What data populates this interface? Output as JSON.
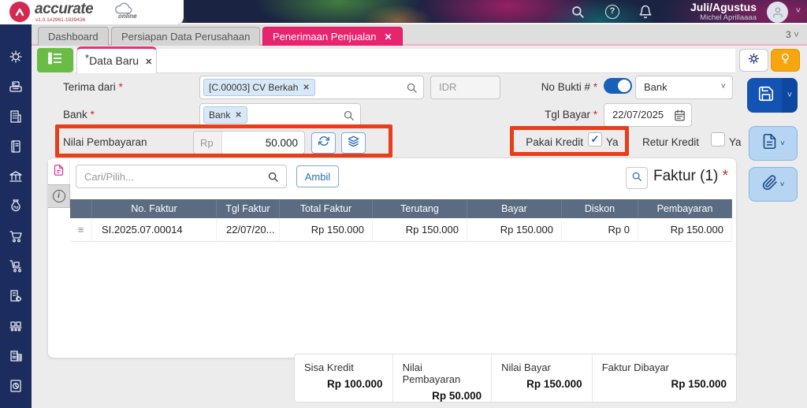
{
  "header": {
    "brand": "accurate",
    "brand_sub": "online",
    "version": "v1.0.1#2961-1939436",
    "period": "Juli/Agustus",
    "user_name": "Michel Aprillaaaa",
    "icons": [
      "search-icon",
      "help-icon",
      "notification-bell-icon",
      "avatar"
    ]
  },
  "tabbar": {
    "tabs": [
      {
        "label": "Dashboard",
        "active": false
      },
      {
        "label": "Persiapan Data Perusahaan",
        "active": false
      },
      {
        "label": "Penerimaan Penjualan",
        "active": true,
        "close": "✕"
      }
    ],
    "overflow_count": "3"
  },
  "sidebar": {
    "items": [
      {
        "icon": "gear-icon"
      },
      {
        "icon": "cash-register-icon"
      },
      {
        "icon": "company-building-icon"
      },
      {
        "icon": "journal-book-icon"
      },
      {
        "icon": "bank-icon"
      },
      {
        "icon": "money-bag-icon"
      },
      {
        "icon": "shopping-cart-icon"
      },
      {
        "icon": "inventory-trolley-icon"
      },
      {
        "icon": "asset-factory-icon"
      },
      {
        "icon": "manufacture-conveyor-icon"
      },
      {
        "icon": "tax-document-icon"
      },
      {
        "icon": "report-chart-icon"
      }
    ]
  },
  "doc_tab": {
    "dirty_marker": "*",
    "label": "Data Baru",
    "close": "✕"
  },
  "required_marker": "*",
  "form": {
    "terima_dari": {
      "label": "Terima dari",
      "chip": "[C.00003] CV Berkah",
      "chip_close": "✕"
    },
    "currency": "IDR",
    "bank": {
      "label": "Bank",
      "chip": "Bank",
      "chip_close": "✕"
    },
    "nilai_pembayaran": {
      "label": "Nilai Pembayaran",
      "prefix": "Rp",
      "value": "50.000"
    },
    "no_bukti": {
      "label": "No Bukti #",
      "toggle_on": true,
      "select_value": "Bank"
    },
    "tgl_bayar": {
      "label": "Tgl Bayar",
      "value": "22/07/2025"
    },
    "pakai_kredit": {
      "label": "Pakai Kredit",
      "checked": true,
      "check_glyph": "✓",
      "option": "Ya"
    },
    "retur_kredit": {
      "label": "Retur Kredit",
      "checked": false,
      "option": "Ya"
    }
  },
  "invoice_panel": {
    "search_placeholder": "Cari/Pilih...",
    "ambil_label": "Ambil",
    "title": "Faktur (1)",
    "table": {
      "columns": [
        "No. Faktur",
        "Tgl Faktur",
        "Total Faktur",
        "Terutang",
        "Bayar",
        "Diskon",
        "Pembayaran"
      ],
      "rows": [
        {
          "no_faktur": "SI.2025.07.00014",
          "tgl_faktur": "22/07/20...",
          "total_faktur": "Rp 150.000",
          "terutang": "Rp 150.000",
          "bayar": "Rp 150.000",
          "diskon": "Rp 0",
          "pembayaran": "Rp 150.000"
        }
      ]
    }
  },
  "summary": {
    "items": [
      {
        "label": "Sisa Kredit",
        "value": "Rp 100.000"
      },
      {
        "label": "Nilai Pembayaran",
        "value": "Rp 50.000"
      },
      {
        "label": "Nilai Bayar",
        "value": "Rp 150.000"
      },
      {
        "label": "Faktur Dibayar",
        "value": "Rp 150.000"
      }
    ]
  },
  "colors": {
    "accent_pink": "#e9246e",
    "annotation_red": "#ea3d19",
    "sidebar_navy": "#1c2c5e",
    "table_header": "#5a6b82",
    "primary_blue": "#1253b4",
    "green_button": "#69bd45",
    "bulb_orange": "#f7a70d"
  }
}
